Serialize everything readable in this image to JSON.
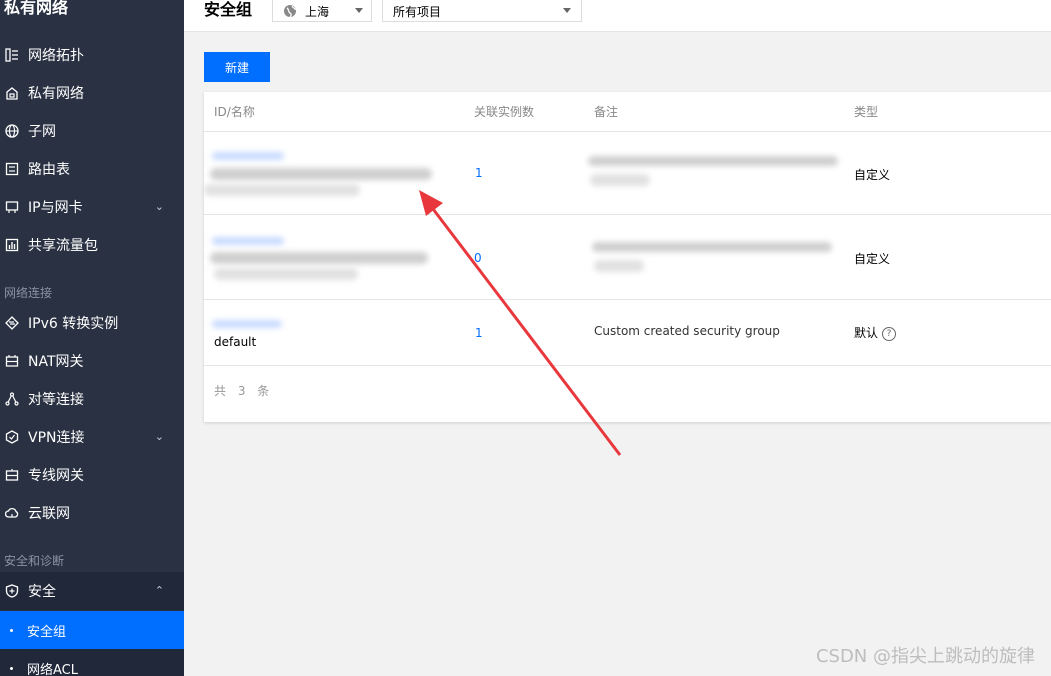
{
  "sidebar": {
    "title": "私有网络",
    "items_top": [
      {
        "label": "网络拓扑",
        "icon": "topology-icon"
      },
      {
        "label": "私有网络",
        "icon": "vpc-icon"
      },
      {
        "label": "子网",
        "icon": "globe-icon"
      },
      {
        "label": "路由表",
        "icon": "route-table-icon"
      },
      {
        "label": "IP与网卡",
        "icon": "ip-card-icon",
        "chevron": "⌄"
      },
      {
        "label": "共享流量包",
        "icon": "traffic-package-icon"
      }
    ],
    "group_network": "网络连接",
    "items_network": [
      {
        "label": "IPv6 转换实例",
        "icon": "ipv6-icon"
      },
      {
        "label": "NAT网关",
        "icon": "nat-gateway-icon"
      },
      {
        "label": "对等连接",
        "icon": "peering-icon"
      },
      {
        "label": "VPN连接",
        "icon": "vpn-icon",
        "chevron": "⌄"
      },
      {
        "label": "专线网关",
        "icon": "direct-connect-icon"
      },
      {
        "label": "云联网",
        "icon": "ccn-icon"
      }
    ],
    "group_security": "安全和诊断",
    "security_item": {
      "label": "安全",
      "icon": "shield-icon",
      "chevron": "⌃"
    },
    "security_children": [
      {
        "label": "安全组",
        "active": true
      },
      {
        "label": "网络ACL",
        "active": false
      }
    ]
  },
  "header": {
    "title": "安全组",
    "region": "上海",
    "project": "所有项目"
  },
  "toolbar": {
    "new_label": "新建"
  },
  "table": {
    "columns": [
      "ID/名称",
      "关联实例数",
      "备注",
      "类型"
    ],
    "rows": [
      {
        "count": "1",
        "type": "自定义"
      },
      {
        "count": "0",
        "type": "自定义"
      },
      {
        "name": "default",
        "count": "1",
        "remark": "Custom created security group",
        "type": "默认"
      }
    ],
    "footer": "共 3 条"
  },
  "watermark": "CSDN @指尖上跳动的旋律",
  "colors": {
    "accent": "#006eff",
    "sidebar_bg": "#293142",
    "arrow": "#e8383d"
  }
}
